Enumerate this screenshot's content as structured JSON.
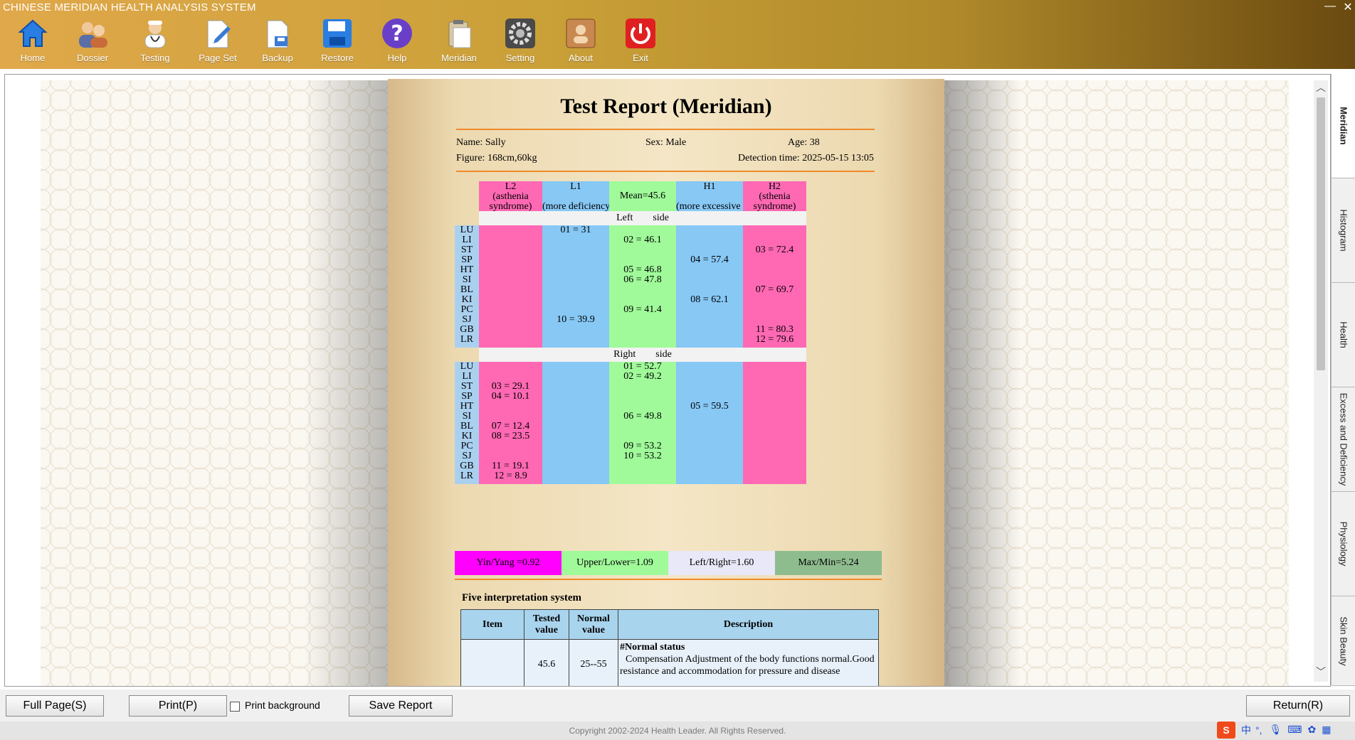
{
  "app": {
    "title": "CHINESE MERIDIAN HEALTH ANALYSIS SYSTEM",
    "minimize": "—",
    "close": "✕"
  },
  "toolbar": [
    {
      "label": "Home",
      "icon": "home-icon"
    },
    {
      "label": "Dossier",
      "icon": "people-icon"
    },
    {
      "label": "Testing",
      "icon": "doctor-icon"
    },
    {
      "label": "Page Set",
      "icon": "page-edit-icon"
    },
    {
      "label": "Backup",
      "icon": "backup-icon"
    },
    {
      "label": "Restore",
      "icon": "save-icon"
    },
    {
      "label": "Help",
      "icon": "help-icon"
    },
    {
      "label": "Meridian",
      "icon": "clipboard-icon"
    },
    {
      "label": "Setting",
      "icon": "gear-icon"
    },
    {
      "label": "About",
      "icon": "about-icon"
    },
    {
      "label": "Exit",
      "icon": "power-icon"
    }
  ],
  "report": {
    "title": "Test Report (Meridian)",
    "name": "Name: Sally",
    "sex": "Sex: Male",
    "age": "Age: 38",
    "figure": "Figure: 168cm,60kg",
    "detection": "Detection time: 2025-05-15 13:05",
    "headers": {
      "l2": "L2\n(asthenia\nsyndrome)",
      "l1": "L1\n\n(more deficiency)",
      "mean": "Mean=45.6",
      "h1": "H1\n\n(more excessive )",
      "h2": "H2\n(sthenia\nsyndrome)"
    },
    "left_side": "Left        side",
    "right_side": "Right        side",
    "meridians": [
      "LU",
      "LI",
      "ST",
      "SP",
      "HT",
      "SI",
      "BL",
      "KI",
      "PC",
      "SJ",
      "GB",
      "LR"
    ],
    "left_values": [
      {
        "row": 0,
        "col": "l1",
        "text": "01 = 31"
      },
      {
        "row": 1,
        "col": "mean",
        "text": "02 = 46.1"
      },
      {
        "row": 2,
        "col": "h2",
        "text": "03 = 72.4"
      },
      {
        "row": 3,
        "col": "h1",
        "text": "04 = 57.4"
      },
      {
        "row": 4,
        "col": "mean",
        "text": "05 = 46.8"
      },
      {
        "row": 5,
        "col": "mean",
        "text": "06 = 47.8"
      },
      {
        "row": 6,
        "col": "h2",
        "text": "07 = 69.7"
      },
      {
        "row": 7,
        "col": "h1",
        "text": "08 = 62.1"
      },
      {
        "row": 8,
        "col": "mean",
        "text": "09 = 41.4"
      },
      {
        "row": 9,
        "col": "l1",
        "text": "10 = 39.9"
      },
      {
        "row": 10,
        "col": "h2",
        "text": "11 = 80.3"
      },
      {
        "row": 11,
        "col": "h2",
        "text": "12 = 79.6"
      }
    ],
    "right_values": [
      {
        "row": 0,
        "col": "mean",
        "text": "01 = 52.7"
      },
      {
        "row": 1,
        "col": "mean",
        "text": "02 = 49.2"
      },
      {
        "row": 2,
        "col": "l2",
        "text": "03 = 29.1"
      },
      {
        "row": 3,
        "col": "l2",
        "text": "04 = 10.1"
      },
      {
        "row": 4,
        "col": "h1",
        "text": "05 = 59.5"
      },
      {
        "row": 5,
        "col": "mean",
        "text": "06 = 49.8"
      },
      {
        "row": 6,
        "col": "l2",
        "text": "07 = 12.4"
      },
      {
        "row": 7,
        "col": "l2",
        "text": "08 = 23.5"
      },
      {
        "row": 8,
        "col": "mean",
        "text": "09 = 53.2"
      },
      {
        "row": 9,
        "col": "mean",
        "text": "10 = 53.2"
      },
      {
        "row": 10,
        "col": "l2",
        "text": "11 = 19.1"
      },
      {
        "row": 11,
        "col": "l2",
        "text": "12 = 8.9"
      }
    ],
    "ratios": {
      "yin_yang": "Yin/Yang =0.92",
      "upper_lower": "Upper/Lower=1.09",
      "left_right": "Left/Right=1.60",
      "max_min": "Max/Min=5.24"
    },
    "five": {
      "title": "Five interpretation system",
      "col_item": "Item",
      "col_tested": "Tested value",
      "col_normal": "Normal value",
      "col_desc": "Description",
      "row_item": "",
      "row_tested": "45.6",
      "row_normal": "25--55",
      "row_desc_title": "#Normal status",
      "row_desc_text": "Compensation Adjustment of the body functions normal.Good resistance and accommodation for pressure and disease"
    },
    "colors": {
      "l2": "#ff69b4",
      "l1": "#87c8f5",
      "mean": "#a0fa9a",
      "h1": "#87c8f5",
      "h2": "#ff69b4",
      "meridian_col": "#aad0f0",
      "side_band": "#f2f2f2",
      "yin_yang": "#ff00ff",
      "upper_lower": "#a0fa9a",
      "left_right": "#e8e8f8",
      "max_min": "#8fbc8f"
    }
  },
  "tabs": [
    "Meridian",
    "Histogram",
    "Health",
    "Excess and Deficiency",
    "Physiology",
    "Skin Beauty"
  ],
  "bottom": {
    "full_page": "Full Page(S)",
    "print": "Print(P)",
    "print_background": "Print background",
    "save_report": "Save Report",
    "return": "Return(R)"
  },
  "footer": "Copyright 2002-2024 Health Leader.  All Rights Reserved.",
  "tray": {
    "ime": "中",
    "punct": "°,"
  }
}
